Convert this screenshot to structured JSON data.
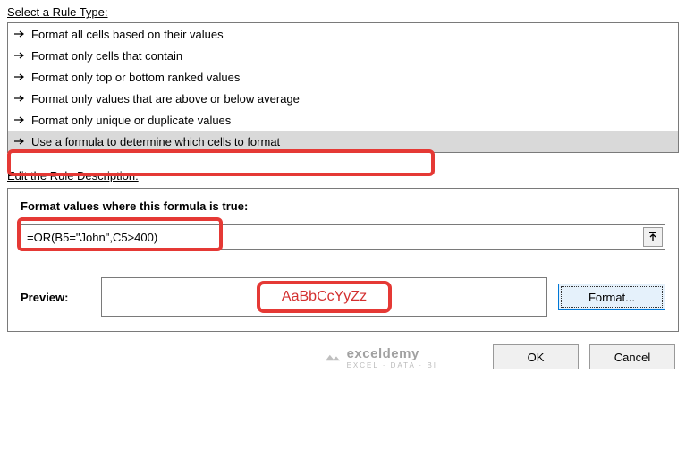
{
  "section1": {
    "label": "Select a Rule Type:"
  },
  "ruleTypes": [
    "Format all cells based on their values",
    "Format only cells that contain",
    "Format only top or bottom ranked values",
    "Format only values that are above or below average",
    "Format only unique or duplicate values",
    "Use a formula to determine which cells to format"
  ],
  "section2": {
    "label": "Edit the Rule Description:",
    "subLabel": "Format values where this formula is true:"
  },
  "formula": {
    "value": "=OR(B5=\"John\",C5>400)"
  },
  "preview": {
    "label": "Preview:",
    "sample": "AaBbCcYyZz",
    "formatBtn": "Format..."
  },
  "buttons": {
    "ok": "OK",
    "cancel": "Cancel"
  },
  "watermark": {
    "brand": "exceldemy",
    "tag": "EXCEL · DATA · BI"
  }
}
